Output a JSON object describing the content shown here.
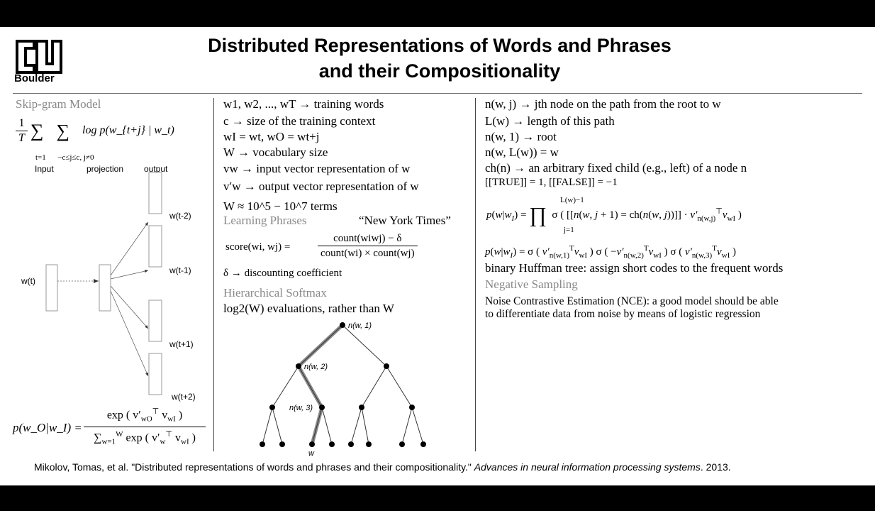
{
  "header": {
    "logo_text": "Boulder",
    "title_line1": "Distributed Representations of Words and Phrases",
    "title_line2": "and their Compositionality"
  },
  "left": {
    "heading": "Skip-gram Model",
    "objective_rhs": "log p(w_{t+j} | w_t)",
    "label_input": "Input",
    "label_projection": "projection",
    "label_output": "output",
    "node_input": "w(t)",
    "outputs": [
      "w(t-2)",
      "w(t-1)",
      "w(t+1)",
      "w(t+2)"
    ],
    "softmax_lhs": "p(w_O|w_I) ="
  },
  "middle": {
    "lines": [
      "w1, w2, ..., wT → training words",
      "c → size of the training context",
      "wI = wt, wO = wt+j",
      "W → vocabulary size",
      "vw → input vector representation of w",
      "v′w → output vector representation of w",
      "W ≈ 10^5 − 10^7 terms"
    ],
    "learning_phrases": "Learning Phrases",
    "new_york_times": "“New York Times”",
    "score_lhs": "score(wi, wj) =",
    "score_num": "count(wiwj) − δ",
    "score_den": "count(wi) × count(wj)",
    "delta_line": "δ → discounting coefficient",
    "hier_softmax": "Hierarchical Softmax",
    "log_line": "log2(W) evaluations, rather than W",
    "tree_labels": [
      "n(w, 1)",
      "n(w, 2)",
      "n(w, 3)",
      "w"
    ]
  },
  "right": {
    "lines": [
      "n(w, j) → jth node on the path from the root to w",
      "L(w) → length of this path",
      "n(w, 1) → root",
      "n(w, L(w)) = w",
      "ch(n) → an arbitrary fixed child (e.g., left) of a node n",
      "[[TRUE]] = 1, [[FALSE]] = −1"
    ],
    "huffman": "binary Huffman tree: assign short codes to the frequent words",
    "neg_sampling": "Negative Sampling",
    "nce_line1": "Noise Contrastive Estimation (NCE): a good model should be able",
    "nce_line2": "to differentiate data from noise by means of logistic regression"
  },
  "footer": {
    "citation": "Mikolov, Tomas, et al. \"Distributed representations of words and phrases and their compositionality.\"",
    "venue": "Advances in neural information processing systems",
    "year": ". 2013."
  }
}
